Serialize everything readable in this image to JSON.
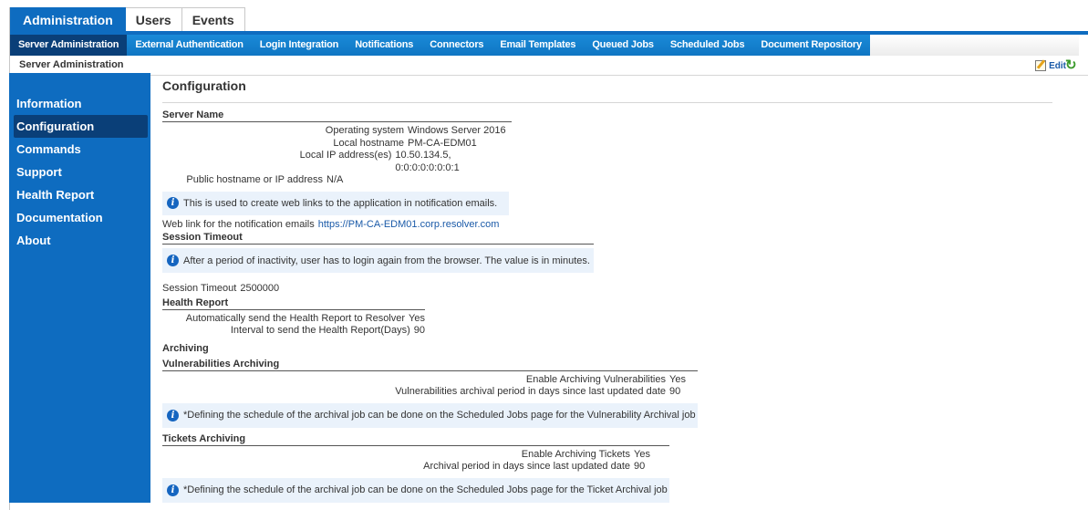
{
  "top_tabs": [
    "Administration",
    "Users",
    "Events"
  ],
  "sub_nav": [
    "Server Administration",
    "External Authentication",
    "Login Integration",
    "Notifications",
    "Connectors",
    "Email Templates",
    "Queued Jobs",
    "Scheduled Jobs",
    "Document Repository"
  ],
  "breadcrumb": "Server Administration",
  "edit_label": "Edit",
  "sidebar": [
    "Information",
    "Configuration",
    "Commands",
    "Support",
    "Health Report",
    "Documentation",
    "About"
  ],
  "page_title": "Configuration",
  "server": {
    "heading": "Server Name",
    "os_label": "Operating system",
    "os_value": "Windows Server 2016",
    "host_label": "Local hostname",
    "host_value": "PM-CA-EDM01",
    "ip_label": "Local IP address(es)",
    "ip_value": "10.50.134.5, 0:0:0:0:0:0:0:1",
    "public_label": "Public hostname or IP address",
    "public_value": "N/A",
    "info": "This is used to create web links to the application in notification emails.",
    "weblink_label": "Web link for the notification emails",
    "weblink_value": "https://PM-CA-EDM01.corp.resolver.com"
  },
  "session": {
    "heading": "Session Timeout",
    "info": "After a period of inactivity, user has to login again from the browser. The value is in minutes.",
    "label": "Session Timeout",
    "value": "2500000"
  },
  "health": {
    "heading": "Health Report",
    "auto_label": "Automatically send the Health Report to Resolver",
    "auto_value": "Yes",
    "interval_label": "Interval to send the Health Report(Days)",
    "interval_value": "90"
  },
  "archiving": {
    "heading": "Archiving",
    "vuln_heading": "Vulnerabilities Archiving",
    "vuln_enable_label": "Enable Archiving Vulnerabilities",
    "vuln_enable_value": "Yes",
    "vuln_period_label": "Vulnerabilities archival period in days since last updated date",
    "vuln_period_value": "90",
    "vuln_info": "*Defining the schedule of the archival job can be done on the Scheduled Jobs page for the Vulnerability Archival job",
    "tickets_heading": "Tickets Archiving",
    "tickets_enable_label": "Enable Archiving Tickets",
    "tickets_enable_value": "Yes",
    "tickets_period_label": "Archival period in days since last updated date",
    "tickets_period_value": "90",
    "tickets_info": "*Defining the schedule of the archival job can be done on the Scheduled Jobs page for the Ticket Archival job"
  }
}
